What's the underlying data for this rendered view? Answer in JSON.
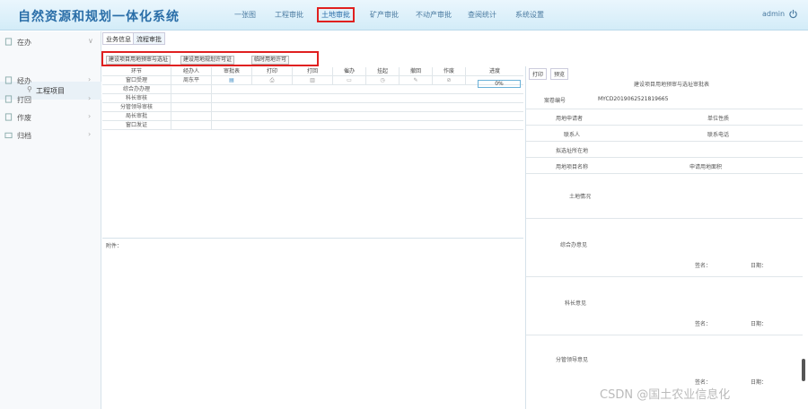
{
  "header": {
    "title": "自然资源和规划一体化系统",
    "nav": [
      "一张图",
      "工程审批",
      "土地审批",
      "矿产审批",
      "不动产审批",
      "查阅统计",
      "系统设置"
    ],
    "active_nav_index": 2,
    "user": "admin"
  },
  "sidebar": {
    "items": [
      {
        "label": "在办",
        "icon": "document-icon"
      },
      {
        "label": "经办",
        "icon": "document-icon"
      },
      {
        "label": "打回",
        "icon": "document-icon"
      },
      {
        "label": "作废",
        "icon": "document-icon"
      },
      {
        "label": "归档",
        "icon": "folder-icon"
      }
    ],
    "sub_item": "工程项目"
  },
  "tabs": [
    "业务信息",
    "流程审批"
  ],
  "actions": [
    "建设项目用地预审与选址",
    "建设用地规划许可证",
    "临时用地许可"
  ],
  "workflow": {
    "headers": [
      "环节",
      "经办人",
      "审批表",
      "打印",
      "打回",
      "催办",
      "挂起",
      "撤回",
      "作废",
      "进度"
    ],
    "rows": [
      "窗口受理",
      "综合办办理",
      "科长审核",
      "分管领导审核",
      "局长审批",
      "窗口发证"
    ],
    "first_row_handler": "周东平",
    "progress": "0%"
  },
  "attach_label": "附件：",
  "rpanel": {
    "tabs": [
      "打印",
      "预览"
    ],
    "form_title": "建设项目用地预审与选址审批表",
    "case_no_label": "案卷编号",
    "case_no": "MYCD2019062521819665",
    "applicant_label": "用地申请者",
    "unit_label": "单位性质",
    "legal_label": "联系人",
    "phone_label": "联系电话",
    "location_label": "拟选址所在地",
    "purpose_label": "用地项目名称",
    "area_label": "申请用地面积",
    "land_label": "土地情况",
    "opinion1_label": "综合办意见",
    "opinion2_label": "科长意见",
    "opinion3_label": "分管领导意见",
    "sign_label": "签名：",
    "date_label": "日期："
  },
  "watermark": "CSDN @国土农业信息化"
}
